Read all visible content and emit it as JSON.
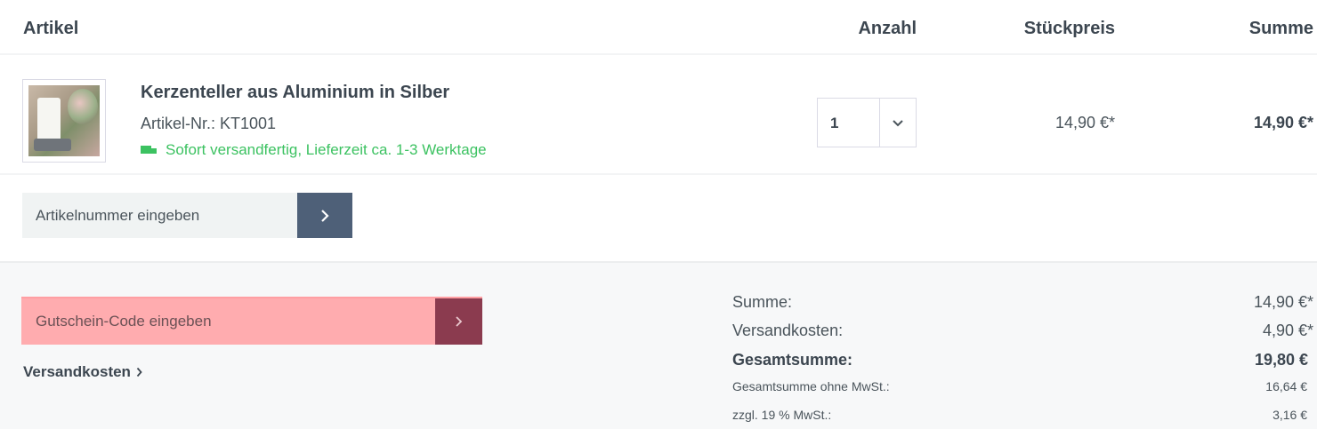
{
  "table_header": {
    "artikel": "Artikel",
    "anzahl": "Anzahl",
    "stueckpreis": "Stückpreis",
    "summe": "Summe"
  },
  "item": {
    "title": "Kerzenteller aus Aluminium in Silber",
    "article_number": "Artikel-Nr.: KT1001",
    "delivery": "Sofort versandfertig, Lieferzeit ca. 1-3 Werktage",
    "quantity": "1",
    "unit_price": "14,90 €*",
    "total": "14,90 €*",
    "icons": {
      "delivery": "truck-icon",
      "quantity": "chevron-down-icon"
    },
    "colors": {
      "delivery": "#3cc261"
    }
  },
  "add_article": {
    "placeholder": "Artikelnummer eingeben",
    "button_icon": "chevron-right-icon",
    "button_color": "#4e6078"
  },
  "voucher": {
    "placeholder": "Gutschein-Code eingeben",
    "button_icon": "chevron-right-icon",
    "highlight_color": "#ffacaf",
    "button_color": "#8b3b4f"
  },
  "shipping_link": "Versandkosten",
  "summary": {
    "subtotal_label": "Summe:",
    "subtotal_value": "14,90 €*",
    "shipping_label": "Versandkosten:",
    "shipping_value": "4,90 €*",
    "grand_total_label": "Gesamtsumme:",
    "grand_total_value": "19,80 €",
    "net_label": "Gesamtsumme ohne MwSt.:",
    "net_value": "16,64 €",
    "vat_label": "zzgl. 19 % MwSt.:",
    "vat_value": "3,16 €"
  }
}
